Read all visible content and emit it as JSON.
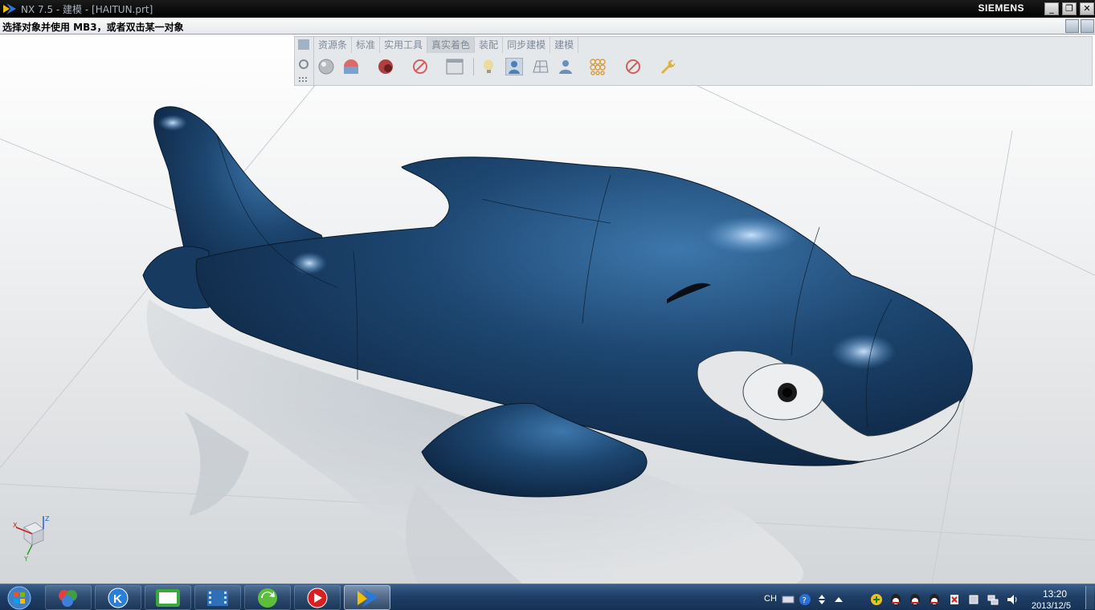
{
  "window": {
    "title": "NX 7.5 - 建模 - [HAITUN.prt]",
    "brand": "SIEMENS",
    "controls": {
      "minimize": "_",
      "restore": "❐",
      "close": "✕"
    }
  },
  "cue": {
    "text": "选择对象并使用 MB3，或者双击某一对象"
  },
  "ribbon": {
    "tabs": [
      {
        "label": "资源条"
      },
      {
        "label": "标准"
      },
      {
        "label": "实用工具"
      },
      {
        "label": "真实着色"
      },
      {
        "label": "装配"
      },
      {
        "label": "同步建模"
      },
      {
        "label": "建模"
      }
    ],
    "icons": [
      "shaded-sphere-icon",
      "material-sphere-icon",
      "red-sphere-icon",
      "no-entry-icon",
      "background-icon",
      "light-bulb-icon",
      "user-view-icon",
      "floor-grid-icon",
      "user-icon",
      "lights-grid-icon",
      "no-entry-icon",
      "wrench-icon"
    ]
  },
  "triad": {
    "x": "X",
    "y": "Y",
    "z": "Z"
  },
  "taskbar": {
    "apps": [
      "orb-icon",
      "k-player-icon",
      "iqiyi-icon",
      "filmstrip-icon",
      "refresh-icon",
      "media-play-icon",
      "nx-icon"
    ],
    "tray": {
      "lang": "CH",
      "time": "13:20",
      "date": "2013/12/5"
    }
  },
  "colors": {
    "model": "#1e4a72",
    "model_highlight": "#5a9ad4",
    "eye_white": "#e9eaeb",
    "taskbar": "#1f3f66"
  }
}
